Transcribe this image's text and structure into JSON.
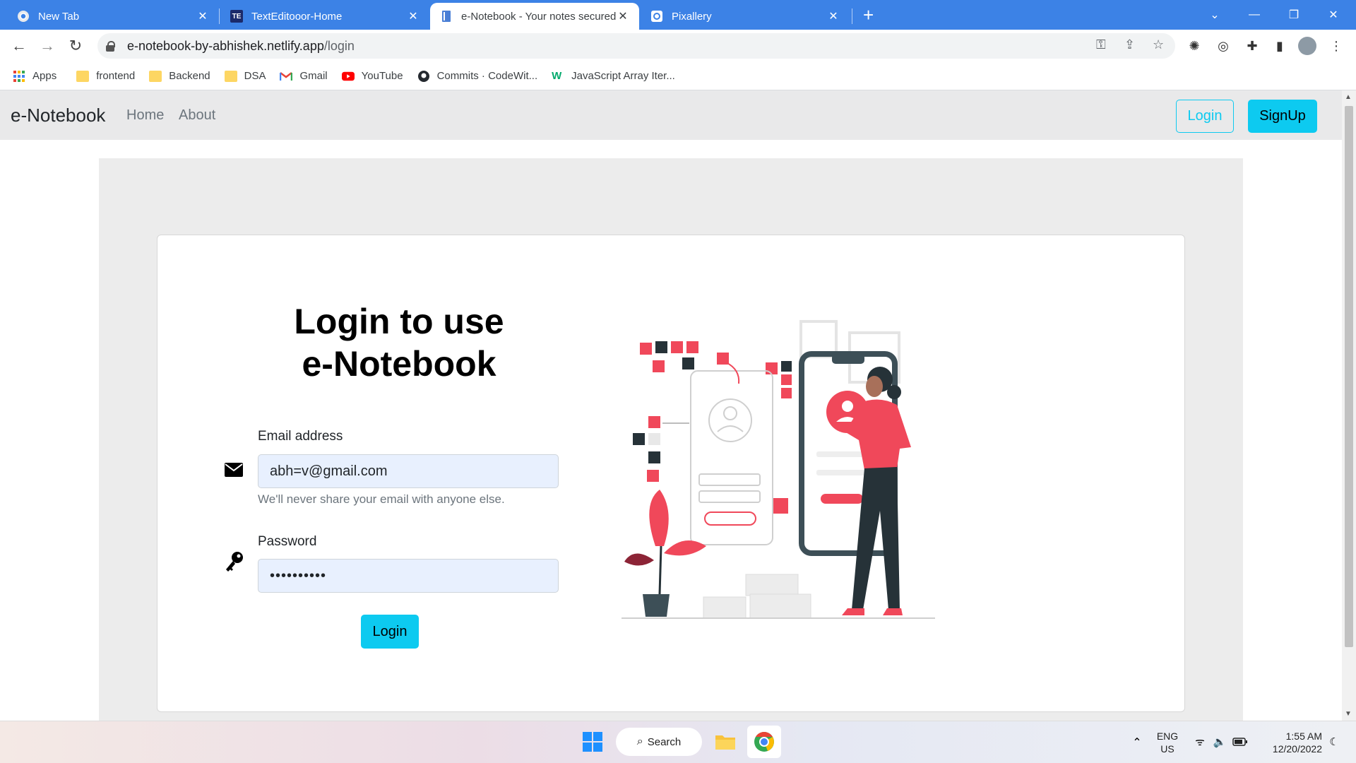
{
  "browser": {
    "tabs": [
      {
        "title": "New Tab",
        "favicon": "chrome-icon",
        "active": false
      },
      {
        "title": "TextEditooor-Home",
        "favicon": "TE",
        "active": false
      },
      {
        "title": "e-Notebook - Your notes secured",
        "favicon": "notebook-icon",
        "active": true
      },
      {
        "title": "Pixallery",
        "favicon": "pixallery-icon",
        "active": false
      }
    ],
    "url_host": "e-notebook-by-abhishek.netlify.app",
    "url_path": "/login",
    "bookmarks": [
      {
        "label": "Apps",
        "icon": "apps-grid-icon"
      },
      {
        "label": "frontend",
        "icon": "folder-icon"
      },
      {
        "label": "Backend",
        "icon": "folder-icon"
      },
      {
        "label": "DSA",
        "icon": "folder-icon"
      },
      {
        "label": "Gmail",
        "icon": "gmail-icon"
      },
      {
        "label": "YouTube",
        "icon": "youtube-icon"
      },
      {
        "label": "Commits · CodeWit...",
        "icon": "github-icon"
      },
      {
        "label": "JavaScript Array Iter...",
        "icon": "w3schools-icon"
      }
    ]
  },
  "app": {
    "brand": "e-Notebook",
    "nav": {
      "home": "Home",
      "about": "About"
    },
    "login_button": "Login",
    "signup_button": "SignUp"
  },
  "login_form": {
    "heading_line1": "Login to use",
    "heading_line2": "e-Notebook",
    "email_label": "Email address",
    "email_value": "abh=v@gmail.com",
    "email_help": "We'll never share your email with anyone else.",
    "password_label": "Password",
    "password_value": "••••••••••",
    "submit_label": "Login"
  },
  "taskbar": {
    "search_label": "Search",
    "lang_line1": "ENG",
    "lang_line2": "US",
    "time": "1:55 AM",
    "date": "12/20/2022"
  },
  "colors": {
    "accent": "#0dcaf0",
    "tabstrip": "#3c82e6",
    "navbar_bg": "#e9e9ea",
    "illustration_red": "#f0485a",
    "illustration_dark": "#263238"
  }
}
